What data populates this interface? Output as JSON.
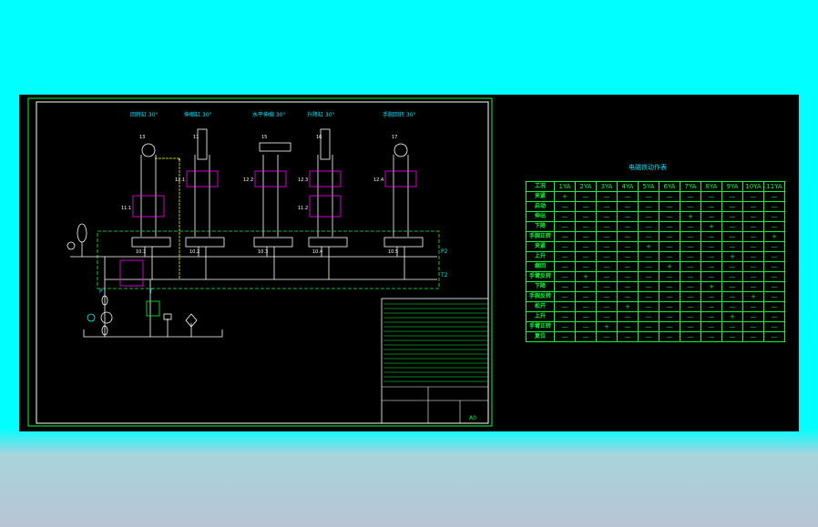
{
  "drawing": {
    "actuator_labels": [
      "回转缸 30°",
      "伸缩缸 30°",
      "水平伸缩 30°",
      "升降缸 30°",
      "手腕回转 30°"
    ],
    "actuator_ids": [
      "13",
      "11",
      "15",
      "16",
      "17"
    ],
    "lock_ids": [
      "12.1",
      "12.2",
      "12.3",
      "12.4"
    ],
    "balance_ids": [
      "11.1",
      "11.2"
    ],
    "valve_ids": [
      "10.1",
      "10.2",
      "10.3",
      "10.4",
      "10.5"
    ],
    "port_labels": {
      "p2": "P2",
      "t2": "T2",
      "p": "P",
      "t": "T"
    },
    "title_block": {
      "scale": "A0"
    }
  },
  "table": {
    "title": "电磁铁动作表",
    "headers": [
      "工况",
      "1YA",
      "2YA",
      "3YA",
      "4YA",
      "5YA",
      "6YA",
      "7YA",
      "8YA",
      "9YA",
      "10YA",
      "11YA"
    ],
    "rows": [
      {
        "label": "夹紧",
        "on": 1
      },
      {
        "label": "启动",
        "on": 0
      },
      {
        "label": "伸出",
        "on": 7
      },
      {
        "label": "下降",
        "on": 8
      },
      {
        "label": "手腕正转",
        "on": 11
      },
      {
        "label": "夹紧",
        "on": 5
      },
      {
        "label": "上升",
        "on": 9
      },
      {
        "label": "缩回",
        "on": 6
      },
      {
        "label": "手臂反转",
        "on": 2
      },
      {
        "label": "下降",
        "on": 8
      },
      {
        "label": "手腕反转",
        "on": 10
      },
      {
        "label": "松开",
        "on": 4
      },
      {
        "label": "上升",
        "on": 9
      },
      {
        "label": "手臂正转",
        "on": 3
      },
      {
        "label": "复位",
        "on": 0
      }
    ],
    "on_symbol": "+",
    "off_symbol": "—"
  },
  "colors": {
    "background": "#00ffff",
    "canvas": "#000000",
    "frame": "#00ff33",
    "lines": "#ffffff",
    "valves": "#ff00ff",
    "text": "#00e5ff"
  }
}
